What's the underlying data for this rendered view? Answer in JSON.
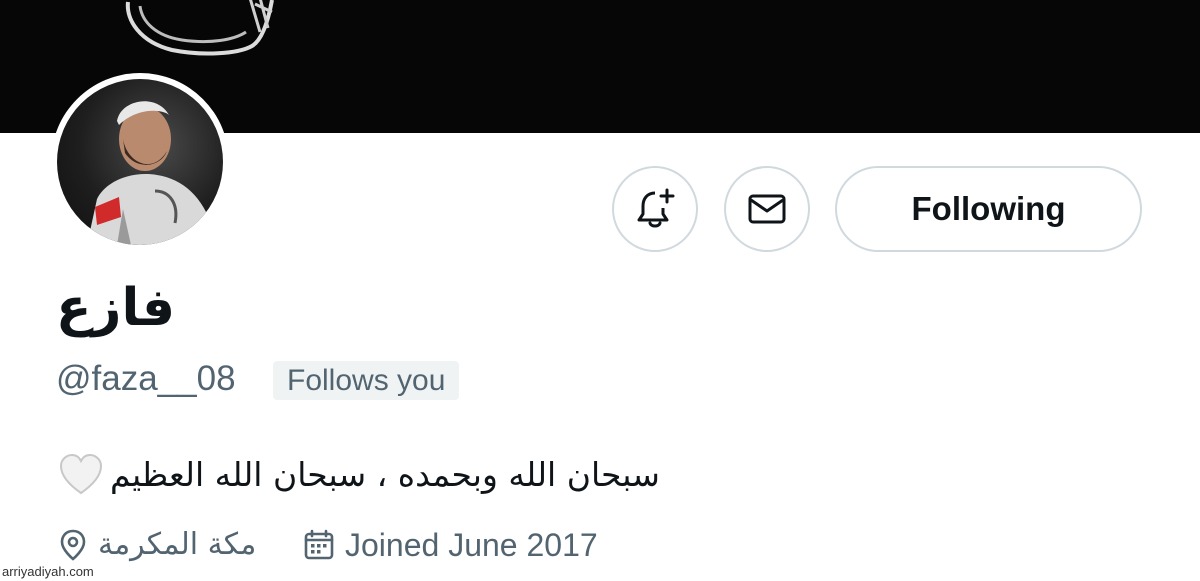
{
  "profile": {
    "display_name": "فازع",
    "handle": "@faza__08",
    "follows_you": "Follows you",
    "bio": "سبحان الله وبحمده ، سبحان الله العظيم",
    "bio_emoji": "white-heart",
    "location": "مكة المكرمة",
    "joined": "Joined June 2017"
  },
  "actions": {
    "notify_icon": "bell-plus-icon",
    "message_icon": "envelope-icon",
    "following_label": "Following"
  },
  "watermark": "arriyadiyah.com",
  "colors": {
    "banner": "#060606",
    "text": "#0f1419",
    "secondary": "#536471",
    "border": "#cfd9de",
    "badge_bg": "#eff3f4"
  }
}
